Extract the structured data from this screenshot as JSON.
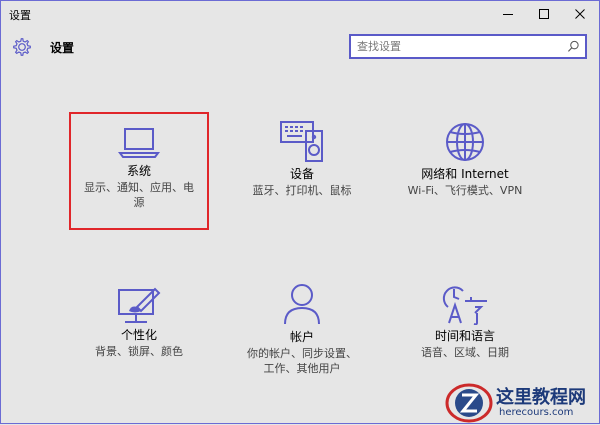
{
  "window": {
    "title": "设置",
    "minimize": "—",
    "maximize": "☐",
    "close": "✕"
  },
  "header": {
    "title": "设置",
    "search_placeholder": "查找设置"
  },
  "tiles": [
    {
      "id": "system",
      "label": "系统",
      "desc_lines": [
        "显示、通知、应用、电",
        "源"
      ],
      "icon": "laptop-icon",
      "selected": true
    },
    {
      "id": "devices",
      "label": "设备",
      "desc_lines": [
        "蓝牙、打印机、鼠标"
      ],
      "icon": "devices-icon"
    },
    {
      "id": "network",
      "label": "网络和 Internet",
      "desc_lines": [
        "Wi-Fi、飞行模式、VPN"
      ],
      "icon": "globe-icon"
    },
    {
      "id": "personalization",
      "label": "个性化",
      "desc_lines": [
        "背景、锁屏、颜色"
      ],
      "icon": "personalization-icon"
    },
    {
      "id": "accounts",
      "label": "帐户",
      "desc_lines": [
        "你的帐户、同步设置、",
        "工作、其他用户"
      ],
      "icon": "person-icon"
    },
    {
      "id": "time-language",
      "label": "时间和语言",
      "desc_lines": [
        "语音、区域、日期"
      ],
      "icon": "time-language-icon"
    }
  ],
  "watermark": {
    "title": "这里教程网",
    "url": "herecours.com"
  },
  "colors": {
    "accent": "#5b5bc8",
    "highlight_border": "#e0262a",
    "background": "#e6e6e6"
  }
}
